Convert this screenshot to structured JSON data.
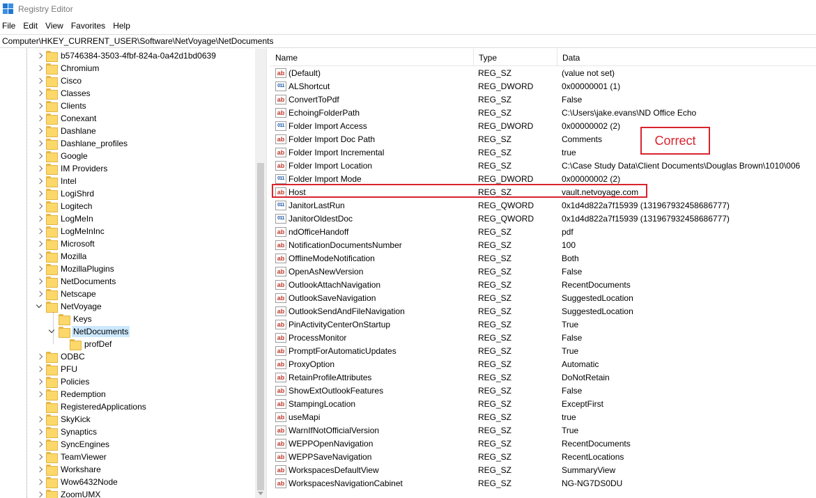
{
  "window": {
    "title": "Registry Editor"
  },
  "menu": [
    "File",
    "Edit",
    "View",
    "Favorites",
    "Help"
  ],
  "address": "Computer\\HKEY_CURRENT_USER\\Software\\NetVoyage\\NetDocuments",
  "tree": [
    {
      "label": "b5746384-3503-4fbf-824a-0a42d1bd0639",
      "level": 0,
      "expander": "right"
    },
    {
      "label": "Chromium",
      "level": 0,
      "expander": "right"
    },
    {
      "label": "Cisco",
      "level": 0,
      "expander": "right"
    },
    {
      "label": "Classes",
      "level": 0,
      "expander": "right"
    },
    {
      "label": "Clients",
      "level": 0,
      "expander": "right"
    },
    {
      "label": "Conexant",
      "level": 0,
      "expander": "right"
    },
    {
      "label": "Dashlane",
      "level": 0,
      "expander": "right"
    },
    {
      "label": "Dashlane_profiles",
      "level": 0,
      "expander": "right"
    },
    {
      "label": "Google",
      "level": 0,
      "expander": "right"
    },
    {
      "label": "IM Providers",
      "level": 0,
      "expander": "right"
    },
    {
      "label": "Intel",
      "level": 0,
      "expander": "right"
    },
    {
      "label": "LogiShrd",
      "level": 0,
      "expander": "right"
    },
    {
      "label": "Logitech",
      "level": 0,
      "expander": "right"
    },
    {
      "label": "LogMeIn",
      "level": 0,
      "expander": "right"
    },
    {
      "label": "LogMeInInc",
      "level": 0,
      "expander": "right"
    },
    {
      "label": "Microsoft",
      "level": 0,
      "expander": "right"
    },
    {
      "label": "Mozilla",
      "level": 0,
      "expander": "right"
    },
    {
      "label": "MozillaPlugins",
      "level": 0,
      "expander": "right"
    },
    {
      "label": "NetDocuments",
      "level": 0,
      "expander": "right"
    },
    {
      "label": "Netscape",
      "level": 0,
      "expander": "right"
    },
    {
      "label": "NetVoyage",
      "level": 0,
      "expander": "down"
    },
    {
      "label": "Keys",
      "level": 1,
      "expander": "none"
    },
    {
      "label": "NetDocuments",
      "level": 1,
      "expander": "down",
      "selected": true
    },
    {
      "label": "profDef",
      "level": 2,
      "expander": "none"
    },
    {
      "label": "ODBC",
      "level": 0,
      "expander": "right"
    },
    {
      "label": "PFU",
      "level": 0,
      "expander": "right"
    },
    {
      "label": "Policies",
      "level": 0,
      "expander": "right"
    },
    {
      "label": "Redemption",
      "level": 0,
      "expander": "right"
    },
    {
      "label": "RegisteredApplications",
      "level": 0,
      "expander": "none"
    },
    {
      "label": "SkyKick",
      "level": 0,
      "expander": "right"
    },
    {
      "label": "Synaptics",
      "level": 0,
      "expander": "right"
    },
    {
      "label": "SyncEngines",
      "level": 0,
      "expander": "right"
    },
    {
      "label": "TeamViewer",
      "level": 0,
      "expander": "right"
    },
    {
      "label": "Workshare",
      "level": 0,
      "expander": "right"
    },
    {
      "label": "Wow6432Node",
      "level": 0,
      "expander": "right"
    },
    {
      "label": "ZoomUMX",
      "level": 0,
      "expander": "right"
    }
  ],
  "columns": {
    "name": "Name",
    "type": "Type",
    "data": "Data"
  },
  "values": [
    {
      "name": "(Default)",
      "type": "REG_SZ",
      "data": "(value not set)",
      "icon": "ab"
    },
    {
      "name": "ALShortcut",
      "type": "REG_DWORD",
      "data": "0x00000001 (1)",
      "icon": "binary"
    },
    {
      "name": "ConvertToPdf",
      "type": "REG_SZ",
      "data": "False",
      "icon": "ab"
    },
    {
      "name": "EchoingFolderPath",
      "type": "REG_SZ",
      "data": "C:\\Users\\jake.evans\\ND Office Echo",
      "icon": "ab"
    },
    {
      "name": "Folder Import Access",
      "type": "REG_DWORD",
      "data": "0x00000002 (2)",
      "icon": "binary"
    },
    {
      "name": "Folder Import Doc Path",
      "type": "REG_SZ",
      "data": "Comments",
      "icon": "ab"
    },
    {
      "name": "Folder Import Incremental",
      "type": "REG_SZ",
      "data": "true",
      "icon": "ab"
    },
    {
      "name": "Folder Import Location",
      "type": "REG_SZ",
      "data": "C:\\Case Study Data\\Client Documents\\Douglas Brown\\1010\\006",
      "icon": "ab"
    },
    {
      "name": "Folder Import Mode",
      "type": "REG_DWORD",
      "data": "0x00000002 (2)",
      "icon": "binary"
    },
    {
      "name": "Host",
      "type": "REG_SZ",
      "data": "vault.netvoyage.com",
      "icon": "ab"
    },
    {
      "name": "JanitorLastRun",
      "type": "REG_QWORD",
      "data": "0x1d4d822a7f15939 (131967932458686777)",
      "icon": "binary"
    },
    {
      "name": "JanitorOldestDoc",
      "type": "REG_QWORD",
      "data": "0x1d4d822a7f15939 (131967932458686777)",
      "icon": "binary"
    },
    {
      "name": "ndOfficeHandoff",
      "type": "REG_SZ",
      "data": "pdf",
      "icon": "ab"
    },
    {
      "name": "NotificationDocumentsNumber",
      "type": "REG_SZ",
      "data": "100",
      "icon": "ab"
    },
    {
      "name": "OfflineModeNotification",
      "type": "REG_SZ",
      "data": "Both",
      "icon": "ab"
    },
    {
      "name": "OpenAsNewVersion",
      "type": "REG_SZ",
      "data": "False",
      "icon": "ab"
    },
    {
      "name": "OutlookAttachNavigation",
      "type": "REG_SZ",
      "data": "RecentDocuments",
      "icon": "ab"
    },
    {
      "name": "OutlookSaveNavigation",
      "type": "REG_SZ",
      "data": "SuggestedLocation",
      "icon": "ab"
    },
    {
      "name": "OutlookSendAndFileNavigation",
      "type": "REG_SZ",
      "data": "SuggestedLocation",
      "icon": "ab"
    },
    {
      "name": "PinActivityCenterOnStartup",
      "type": "REG_SZ",
      "data": "True",
      "icon": "ab"
    },
    {
      "name": "ProcessMonitor",
      "type": "REG_SZ",
      "data": "False",
      "icon": "ab"
    },
    {
      "name": "PromptForAutomaticUpdates",
      "type": "REG_SZ",
      "data": "True",
      "icon": "ab"
    },
    {
      "name": "ProxyOption",
      "type": "REG_SZ",
      "data": "Automatic",
      "icon": "ab"
    },
    {
      "name": "RetainProfileAttributes",
      "type": "REG_SZ",
      "data": "DoNotRetain",
      "icon": "ab"
    },
    {
      "name": "ShowExtOutlookFeatures",
      "type": "REG_SZ",
      "data": "False",
      "icon": "ab"
    },
    {
      "name": "StampingLocation",
      "type": "REG_SZ",
      "data": "ExceptFirst",
      "icon": "ab"
    },
    {
      "name": "useMapi",
      "type": "REG_SZ",
      "data": "true",
      "icon": "ab"
    },
    {
      "name": "WarnIfNotOfficialVersion",
      "type": "REG_SZ",
      "data": "True",
      "icon": "ab"
    },
    {
      "name": "WEPPOpenNavigation",
      "type": "REG_SZ",
      "data": "RecentDocuments",
      "icon": "ab"
    },
    {
      "name": "WEPPSaveNavigation",
      "type": "REG_SZ",
      "data": "RecentLocations",
      "icon": "ab"
    },
    {
      "name": "WorkspacesDefaultView",
      "type": "REG_SZ",
      "data": "SummaryView",
      "icon": "ab"
    },
    {
      "name": "WorkspacesNavigationCabinet",
      "type": "REG_SZ",
      "data": "NG-NG7DS0DU",
      "icon": "ab"
    }
  ],
  "annotation": {
    "text": "Correct",
    "color": "#d9232e"
  }
}
